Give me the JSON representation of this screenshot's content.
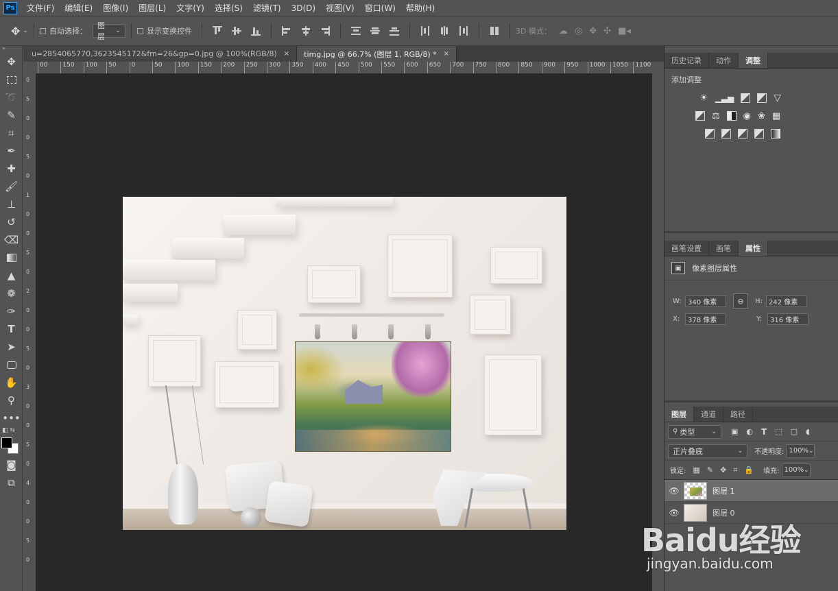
{
  "app": {
    "logo": "Ps"
  },
  "menu": [
    "文件(F)",
    "编辑(E)",
    "图像(I)",
    "图层(L)",
    "文字(Y)",
    "选择(S)",
    "滤镜(T)",
    "3D(D)",
    "视图(V)",
    "窗口(W)",
    "帮助(H)"
  ],
  "options": {
    "auto_select_label": "自动选择：",
    "auto_select_value": "图层",
    "show_transform_label": "显示变换控件",
    "mode_3d_label": "3D 模式："
  },
  "tabs": [
    {
      "title": "u=2854065770,3623545172&fm=26&gp=0.jpg @ 100%(RGB/8)",
      "close": "×"
    },
    {
      "title": "timg.jpg @ 66.7% (图层 1, RGB/8) *",
      "close": "×"
    }
  ],
  "ruler_top": [
    "00",
    "150",
    "100",
    "50",
    "0",
    "50",
    "100",
    "150",
    "200",
    "250",
    "300",
    "350",
    "400",
    "450",
    "500",
    "550",
    "600",
    "650",
    "700",
    "750",
    "800",
    "850",
    "900",
    "950",
    "1000",
    "1050",
    "1100",
    "1150"
  ],
  "ruler_left": [
    "0",
    "5",
    "0",
    "0",
    "5",
    "0",
    "1",
    "0",
    "0",
    "5",
    "0",
    "2",
    "0",
    "0",
    "5",
    "0",
    "3",
    "0",
    "0",
    "5",
    "0",
    "4",
    "0",
    "0",
    "5",
    "0"
  ],
  "panel_top": {
    "tabs": [
      "历史记录",
      "动作",
      "调整"
    ],
    "title": "添加调整"
  },
  "panel_props": {
    "tabs": [
      "画笔设置",
      "画笔",
      "属性"
    ],
    "title": "像素图层属性",
    "w_label": "W:",
    "w_value": "340 像素",
    "h_label": "H:",
    "h_value": "242 像素",
    "x_label": "X:",
    "x_value": "378 像素",
    "y_label": "Y:",
    "y_value": "316 像素"
  },
  "panel_layers": {
    "tabs": [
      "图层",
      "通道",
      "路径"
    ],
    "filter_label": "类型",
    "blend_mode": "正片叠底",
    "opacity_label": "不透明度:",
    "opacity_value": "100%",
    "lock_label": "锁定:",
    "fill_label": "填充:",
    "fill_value": "100%",
    "layers": [
      {
        "name": "图层 1"
      },
      {
        "name": "图层 0"
      }
    ]
  },
  "watermark": {
    "main": "Baidu经验",
    "url": "jingyan.baidu.com"
  },
  "colors": {
    "bg": "#535353",
    "canvas": "#282828",
    "accent": "#31a8ff"
  }
}
